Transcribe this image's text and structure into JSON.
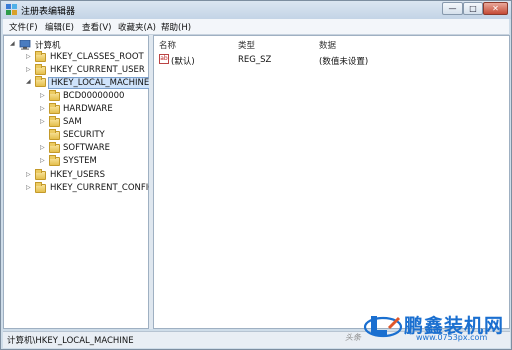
{
  "window": {
    "title": "注册表编辑器",
    "min": "—",
    "max": "□",
    "close": "✕"
  },
  "menu": [
    "文件(F)",
    "编辑(E)",
    "查看(V)",
    "收藏夹(A)",
    "帮助(H)"
  ],
  "tree": {
    "root": "计算机",
    "keys": [
      "HKEY_CLASSES_ROOT",
      "HKEY_CURRENT_USER",
      "HKEY_LOCAL_MACHINE",
      "BCD00000000",
      "HARDWARE",
      "SAM",
      "SECURITY",
      "SOFTWARE",
      "SYSTEM",
      "HKEY_USERS",
      "HKEY_CURRENT_CONFIG"
    ],
    "selected": "HKEY_LOCAL_MACHINE"
  },
  "list": {
    "columns": [
      "名称",
      "类型",
      "数据"
    ],
    "rows": [
      {
        "name": "(默认)",
        "type": "REG_SZ",
        "data": "(数值未设置)"
      }
    ]
  },
  "status": {
    "path": "计算机\\HKEY_LOCAL_MACHINE"
  },
  "watermark": {
    "brand": "鹏鑫装机网",
    "url": "www.0753px.com",
    "small": "头条"
  },
  "colors": {
    "selection": "#cfe3fb",
    "watermark": "#1a6fd0",
    "folder": "#e4bf4d"
  }
}
